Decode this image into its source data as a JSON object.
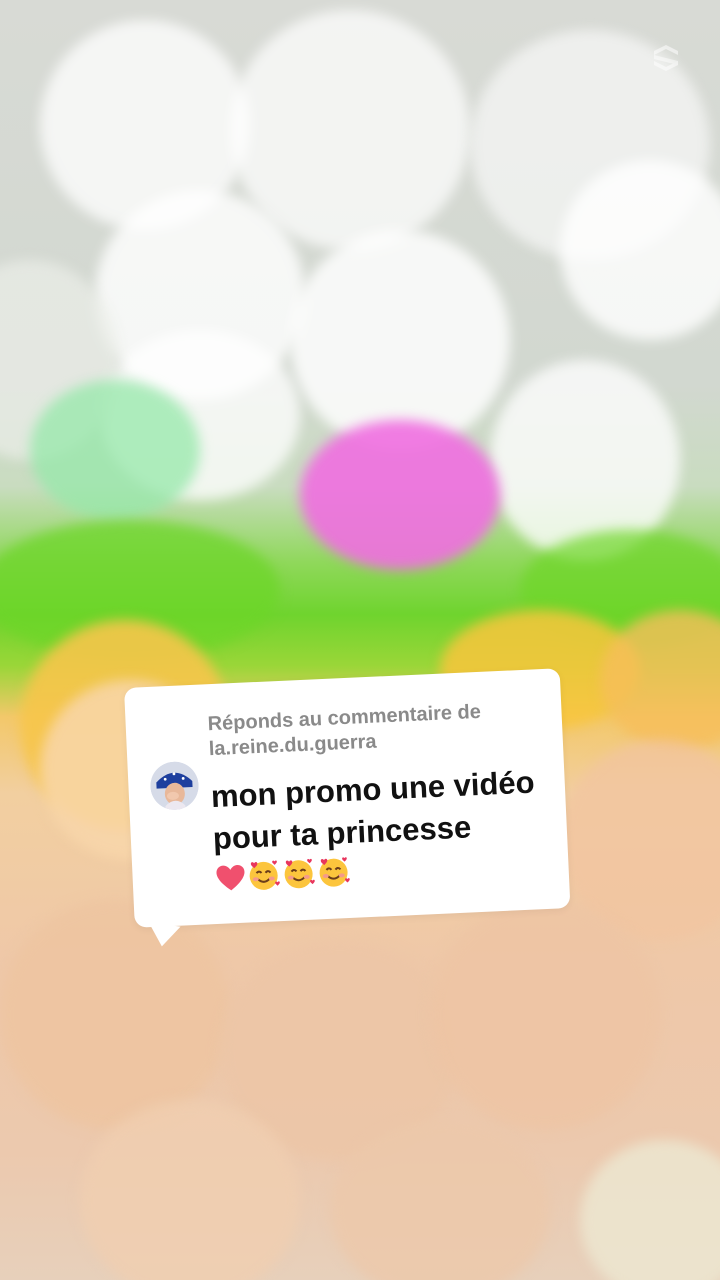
{
  "background": {
    "description_colors": {
      "top": "#d8dad5",
      "middle_green": "#6fd42e",
      "magenta": "#f06ee0",
      "orange": "#f6c54a",
      "bottom": "#ecc9ae"
    }
  },
  "watermark": {
    "icon": "capcut-logo-icon"
  },
  "reply_bubble": {
    "header_prefix": "Réponds au commentaire de",
    "username": "la.reine.du.guerra",
    "comment_text": "mon promo une vidéo pour ta princesse",
    "emojis": [
      "heart-icon",
      "smiling-face-with-hearts-icon",
      "smiling-face-with-hearts-icon",
      "smiling-face-with-hearts-icon"
    ],
    "avatar_icon": "user-avatar"
  }
}
